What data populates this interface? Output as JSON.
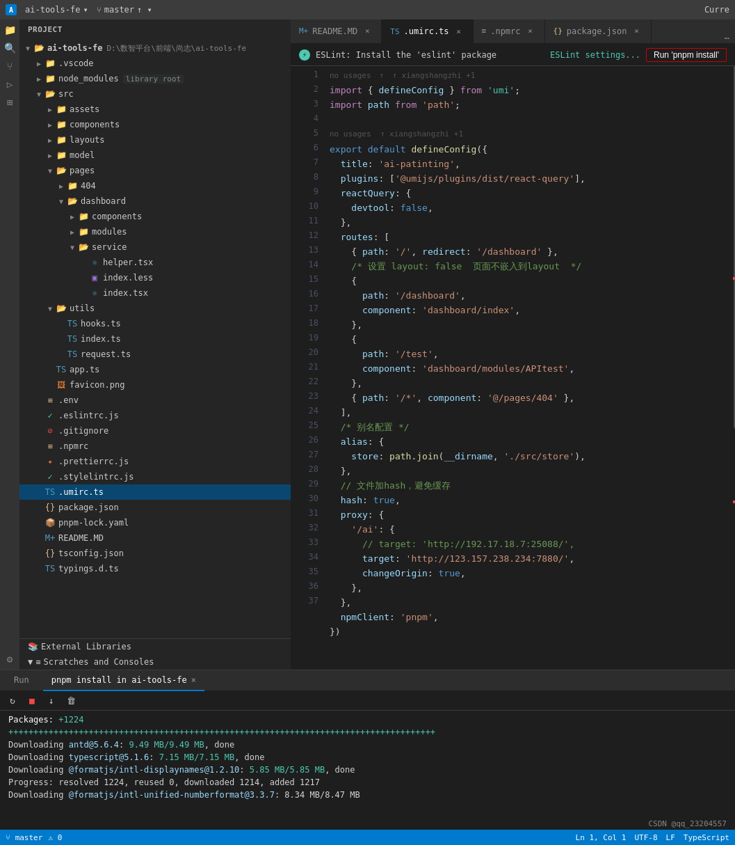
{
  "topbar": {
    "logo": "A",
    "project": "ai-tools-fe",
    "branch": "master",
    "currentFile": "Curre"
  },
  "sidebar": {
    "header": "Project",
    "tree": [
      {
        "id": "root",
        "label": "ai-tools-fe",
        "type": "folder-open",
        "level": 0,
        "path": "D:\\数智平台\\前端\\尚志\\ai-tools-fe",
        "expanded": true
      },
      {
        "id": "vscode",
        "label": ".vscode",
        "type": "folder",
        "level": 1,
        "expanded": false
      },
      {
        "id": "node_modules",
        "label": "node_modules",
        "type": "folder-open",
        "level": 1,
        "badge": "library root",
        "expanded": false
      },
      {
        "id": "src",
        "label": "src",
        "type": "folder-open",
        "level": 1,
        "expanded": true
      },
      {
        "id": "assets",
        "label": "assets",
        "type": "folder",
        "level": 2,
        "expanded": false
      },
      {
        "id": "components",
        "label": "components",
        "type": "folder",
        "level": 2,
        "expanded": false
      },
      {
        "id": "layouts",
        "label": "layouts",
        "type": "folder",
        "level": 2,
        "expanded": false
      },
      {
        "id": "model",
        "label": "model",
        "type": "folder",
        "level": 2,
        "expanded": false
      },
      {
        "id": "pages",
        "label": "pages",
        "type": "folder-open",
        "level": 2,
        "expanded": true
      },
      {
        "id": "404",
        "label": "404",
        "type": "folder",
        "level": 3,
        "expanded": false
      },
      {
        "id": "dashboard",
        "label": "dashboard",
        "type": "folder-open",
        "level": 3,
        "expanded": true
      },
      {
        "id": "dash-components",
        "label": "components",
        "type": "folder",
        "level": 4,
        "expanded": false
      },
      {
        "id": "dash-modules",
        "label": "modules",
        "type": "folder",
        "level": 4,
        "expanded": false
      },
      {
        "id": "service",
        "label": "service",
        "type": "folder-open",
        "level": 4,
        "expanded": true
      },
      {
        "id": "helper-tsx",
        "label": "helper.tsx",
        "type": "file-tsx",
        "level": 5
      },
      {
        "id": "index-less",
        "label": "index.less",
        "type": "file-less",
        "level": 5
      },
      {
        "id": "index-tsx",
        "label": "index.tsx",
        "type": "file-tsx",
        "level": 5
      },
      {
        "id": "utils",
        "label": "utils",
        "type": "folder-open",
        "level": 2,
        "expanded": true
      },
      {
        "id": "hooks-ts",
        "label": "hooks.ts",
        "type": "file-ts",
        "level": 3
      },
      {
        "id": "index-ts",
        "label": "index.ts",
        "type": "file-ts",
        "level": 3
      },
      {
        "id": "request-ts",
        "label": "request.ts",
        "type": "file-ts",
        "level": 3
      },
      {
        "id": "app-ts",
        "label": "app.ts",
        "type": "file-ts",
        "level": 2
      },
      {
        "id": "favicon",
        "label": "favicon.png",
        "type": "file-png",
        "level": 2
      },
      {
        "id": "env",
        "label": ".env",
        "type": "file-env",
        "level": 1
      },
      {
        "id": "eslintrc",
        "label": ".eslintrc.js",
        "type": "file-eslint",
        "level": 1
      },
      {
        "id": "gitignore",
        "label": ".gitignore",
        "type": "file-git",
        "level": 1
      },
      {
        "id": "npmrc",
        "label": ".npmrc",
        "type": "file-npm",
        "level": 1
      },
      {
        "id": "prettierrc",
        "label": ".prettierrc.js",
        "type": "file-prettier",
        "level": 1
      },
      {
        "id": "stylelintrc",
        "label": ".stylelintrc.js",
        "type": "file-stylelint",
        "level": 1
      },
      {
        "id": "umirc",
        "label": ".umirc.ts",
        "type": "file-umirc",
        "level": 1,
        "active": true
      },
      {
        "id": "package-json",
        "label": "package.json",
        "type": "file-json",
        "level": 1
      },
      {
        "id": "pnpm-lock",
        "label": "pnpm-lock.yaml",
        "type": "file-yaml",
        "level": 1
      },
      {
        "id": "readme-md",
        "label": "README.MD",
        "type": "file-md",
        "level": 1
      },
      {
        "id": "tsconfig",
        "label": "tsconfig.json",
        "type": "file-json",
        "level": 1
      },
      {
        "id": "typings",
        "label": "typings.d.ts",
        "type": "file-ts",
        "level": 1
      }
    ],
    "bottomItems": [
      {
        "id": "ext-libs",
        "label": "External Libraries"
      },
      {
        "id": "scratches",
        "label": "Scratches and Consoles"
      }
    ]
  },
  "tabs": [
    {
      "id": "readme",
      "label": "README.MD",
      "icon": "M+",
      "active": false,
      "modified": false
    },
    {
      "id": "umirc",
      "label": ".umirc.ts",
      "icon": "TS",
      "active": true,
      "modified": false
    },
    {
      "id": "npmrc",
      "label": ".npmrc",
      "icon": "≡",
      "active": false,
      "modified": false
    },
    {
      "id": "package-json",
      "label": "package.json",
      "icon": "{}",
      "active": false,
      "modified": false
    }
  ],
  "eslint": {
    "icon": "⚡",
    "message": "ESLint: Install the 'eslint' package",
    "settings_label": "ESLint settings...",
    "run_label": "Run 'pnpm install'"
  },
  "code": {
    "filename": ".umirc.ts",
    "hint_usages": "no usages",
    "hint_author": "↑ xiangshangzhi +1",
    "lines": [
      {
        "n": 1,
        "text": "import { defineConfig } from 'umi';"
      },
      {
        "n": 2,
        "text": "import path from 'path';"
      },
      {
        "n": 3,
        "text": ""
      },
      {
        "n": 4,
        "text": "export default defineConfig({"
      },
      {
        "n": 5,
        "text": "  title: 'ai-patinting',"
      },
      {
        "n": 6,
        "text": "  plugins: ['@umijs/plugins/dist/react-query'],"
      },
      {
        "n": 7,
        "text": "  reactQuery: {"
      },
      {
        "n": 8,
        "text": "    devtool: false,"
      },
      {
        "n": 9,
        "text": "  },"
      },
      {
        "n": 10,
        "text": "  routes: ["
      },
      {
        "n": 11,
        "text": "    { path: '/', redirect: '/dashboard' },"
      },
      {
        "n": 12,
        "text": "    /* 设置 layout: false  页面不嵌入到layout  */"
      },
      {
        "n": 13,
        "text": "    {"
      },
      {
        "n": 14,
        "text": "      path: '/dashboard',"
      },
      {
        "n": 15,
        "text": "      component: 'dashboard/index',"
      },
      {
        "n": 16,
        "text": "    },"
      },
      {
        "n": 17,
        "text": "    {"
      },
      {
        "n": 18,
        "text": "      path: '/test',"
      },
      {
        "n": 19,
        "text": "      component: 'dashboard/modules/APItest',"
      },
      {
        "n": 20,
        "text": "    },"
      },
      {
        "n": 21,
        "text": "    { path: '/*', component: '@/pages/404' },"
      },
      {
        "n": 22,
        "text": "  ],"
      },
      {
        "n": 23,
        "text": "  /* 别名配置 */"
      },
      {
        "n": 24,
        "text": "  alias: {"
      },
      {
        "n": 25,
        "text": "    store: path.join(__dirname, './src/store'),"
      },
      {
        "n": 26,
        "text": "  },"
      },
      {
        "n": 27,
        "text": "  // 文件加hash，避免缓存"
      },
      {
        "n": 28,
        "text": "  hash: true,"
      },
      {
        "n": 29,
        "text": "  proxy: {"
      },
      {
        "n": 30,
        "text": "    '/ai': {"
      },
      {
        "n": 31,
        "text": "      // target: 'http://192.17.18.7:25088/',"
      },
      {
        "n": 32,
        "text": "      target: 'http://123.157.238.234:7880/',"
      },
      {
        "n": 33,
        "text": "      changeOrigin: true,"
      },
      {
        "n": 34,
        "text": "    },"
      },
      {
        "n": 35,
        "text": "  },"
      },
      {
        "n": 36,
        "text": "  npmClient: 'pnpm',"
      },
      {
        "n": 37,
        "text": "})"
      }
    ]
  },
  "bottom_panel": {
    "tabs": [
      {
        "id": "run",
        "label": "Run",
        "active": false
      },
      {
        "id": "pnpm-install",
        "label": "pnpm install in ai-tools-fe",
        "active": true,
        "closeable": true
      }
    ],
    "terminal": [
      {
        "text": "Packages: +1224",
        "class": "term-white"
      },
      {
        "text": "+++++++++++++++++++++++++++++++++++++++++++++++++++++++++++++++++++++++++++++++++++++",
        "class": "term-progress"
      },
      {
        "text": "Downloading antd@5.6.4: 9.49 MB/9.49 MB, done",
        "class": "term-brand"
      },
      {
        "text": "Downloading typescript@5.1.6: 7.15 MB/7.15 MB, done",
        "class": "term-brand"
      },
      {
        "text": "Downloading @formatjs/intl-displaynames@1.2.10: 5.85 MB/5.85 MB, done",
        "class": "term-brand"
      },
      {
        "text": "Progress: resolved 1224, reused 0, downloaded 1214, added 1217",
        "class": "term-brand"
      },
      {
        "text": "Downloading @formatjs/intl-unified-numberformat@3.3.7: 8.34 MB/8.47 MB",
        "class": "term-brand"
      }
    ],
    "branding": "CSDN @qq_23204557"
  },
  "statusbar": {
    "git_branch": "master",
    "errors": "0",
    "warnings": "0",
    "encoding": "UTF-8",
    "line_ending": "LF",
    "language": "TypeScript",
    "line_col": "Ln 1, Col 1"
  }
}
